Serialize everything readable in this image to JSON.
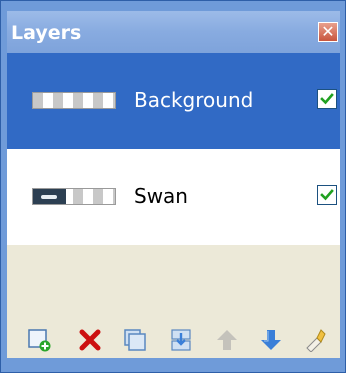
{
  "panel": {
    "title": "Layers",
    "close_glyph": "✕"
  },
  "layers": [
    {
      "name": "Background",
      "visible": true,
      "selected": true,
      "thumbnail": "checkerboard"
    },
    {
      "name": "Swan",
      "visible": true,
      "selected": false,
      "thumbnail": "swan-image"
    }
  ],
  "toolbar": {
    "buttons": [
      "add-layer-icon",
      "delete-layer-icon",
      "duplicate-layer-icon",
      "merge-down-icon",
      "move-layer-up-icon",
      "move-layer-down-icon",
      "layer-properties-icon"
    ]
  },
  "colors": {
    "titlebar": "#88abe0",
    "selection": "#316ac5",
    "panel_background": "#ece9d8",
    "checkbox_check": "#21a121",
    "delete_red": "#cc1010",
    "arrow_blue": "#3a7fd8"
  }
}
